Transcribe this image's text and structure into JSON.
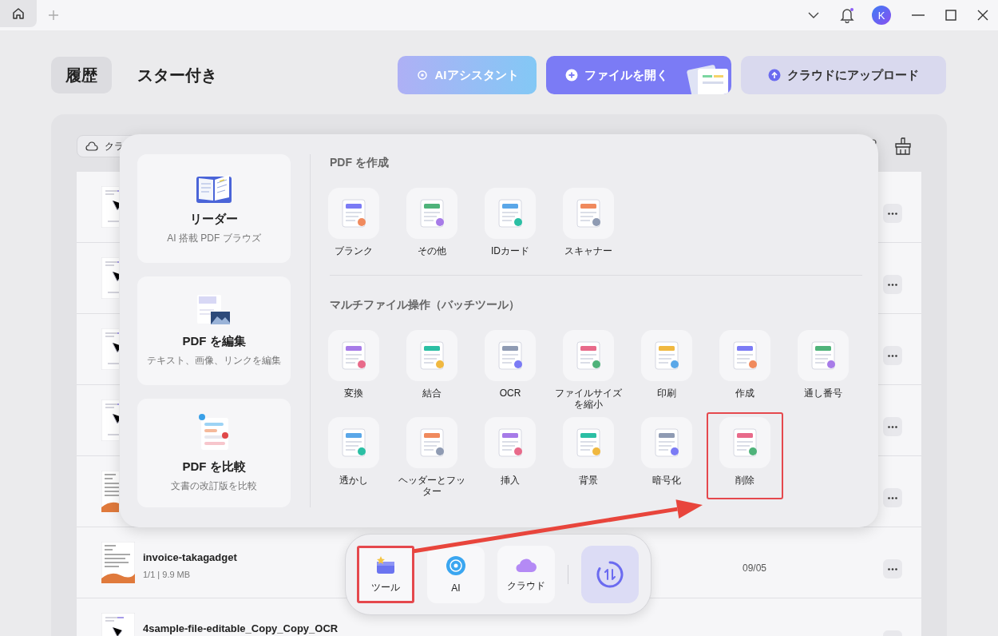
{
  "titlebar": {
    "avatar_initial": "K"
  },
  "tabs": [
    {
      "label": "履歴",
      "selected": true
    },
    {
      "label": "スター付き",
      "selected": false
    }
  ],
  "actions": [
    {
      "label": "AIアシスタント",
      "kind": "ai"
    },
    {
      "label": "ファイルを開く",
      "kind": "open"
    },
    {
      "label": "クラウドにアップロード",
      "kind": "upload"
    }
  ],
  "filter": {
    "label": "クラ"
  },
  "files": [
    {
      "kind": "sketch"
    },
    {
      "kind": "sketch"
    },
    {
      "kind": "sketch"
    },
    {
      "kind": "sketch"
    },
    {
      "kind": "invoice"
    },
    {
      "kind": "invoice",
      "name": "invoice-takagadget",
      "meta": "1/1 | 9.9 MB",
      "date": "09/05"
    },
    {
      "kind": "sketch",
      "name": "4sample-file-editable_Copy_Copy_OCR"
    }
  ],
  "tools_popup": {
    "cards": [
      {
        "title": "リーダー",
        "subtitle": "AI 搭載 PDF ブラウズ"
      },
      {
        "title": "PDF を編集",
        "subtitle": "テキスト、画像、リンクを編集"
      },
      {
        "title": "PDF を比較",
        "subtitle": "文書の改訂版を比較"
      }
    ],
    "sections": [
      {
        "heading": "PDF を作成",
        "tools": [
          {
            "label": "ブランク",
            "highlighted": false
          },
          {
            "label": "その他",
            "highlighted": false
          },
          {
            "label": "IDカード",
            "highlighted": false
          },
          {
            "label": "スキャナー",
            "highlighted": false
          }
        ]
      },
      {
        "heading": "マルチファイル操作（バッチツール）",
        "tools": [
          {
            "label": "変換",
            "highlighted": false
          },
          {
            "label": "結合",
            "highlighted": false
          },
          {
            "label": "OCR",
            "highlighted": false
          },
          {
            "label": "ファイルサイズを縮小",
            "highlighted": false
          },
          {
            "label": "印刷",
            "highlighted": false
          },
          {
            "label": "作成",
            "highlighted": false
          },
          {
            "label": "通し番号",
            "highlighted": false
          },
          {
            "label": "透かし",
            "highlighted": false
          },
          {
            "label": "ヘッダーとフッター",
            "highlighted": false
          },
          {
            "label": "挿入",
            "highlighted": false
          },
          {
            "label": "背景",
            "highlighted": false
          },
          {
            "label": "暗号化",
            "highlighted": false
          },
          {
            "label": "削除",
            "highlighted": true
          }
        ]
      }
    ]
  },
  "dock": {
    "items": [
      {
        "label": "ツール",
        "highlighted": true
      },
      {
        "label": "AI",
        "highlighted": false
      },
      {
        "label": "クラウド",
        "highlighted": false
      }
    ]
  }
}
